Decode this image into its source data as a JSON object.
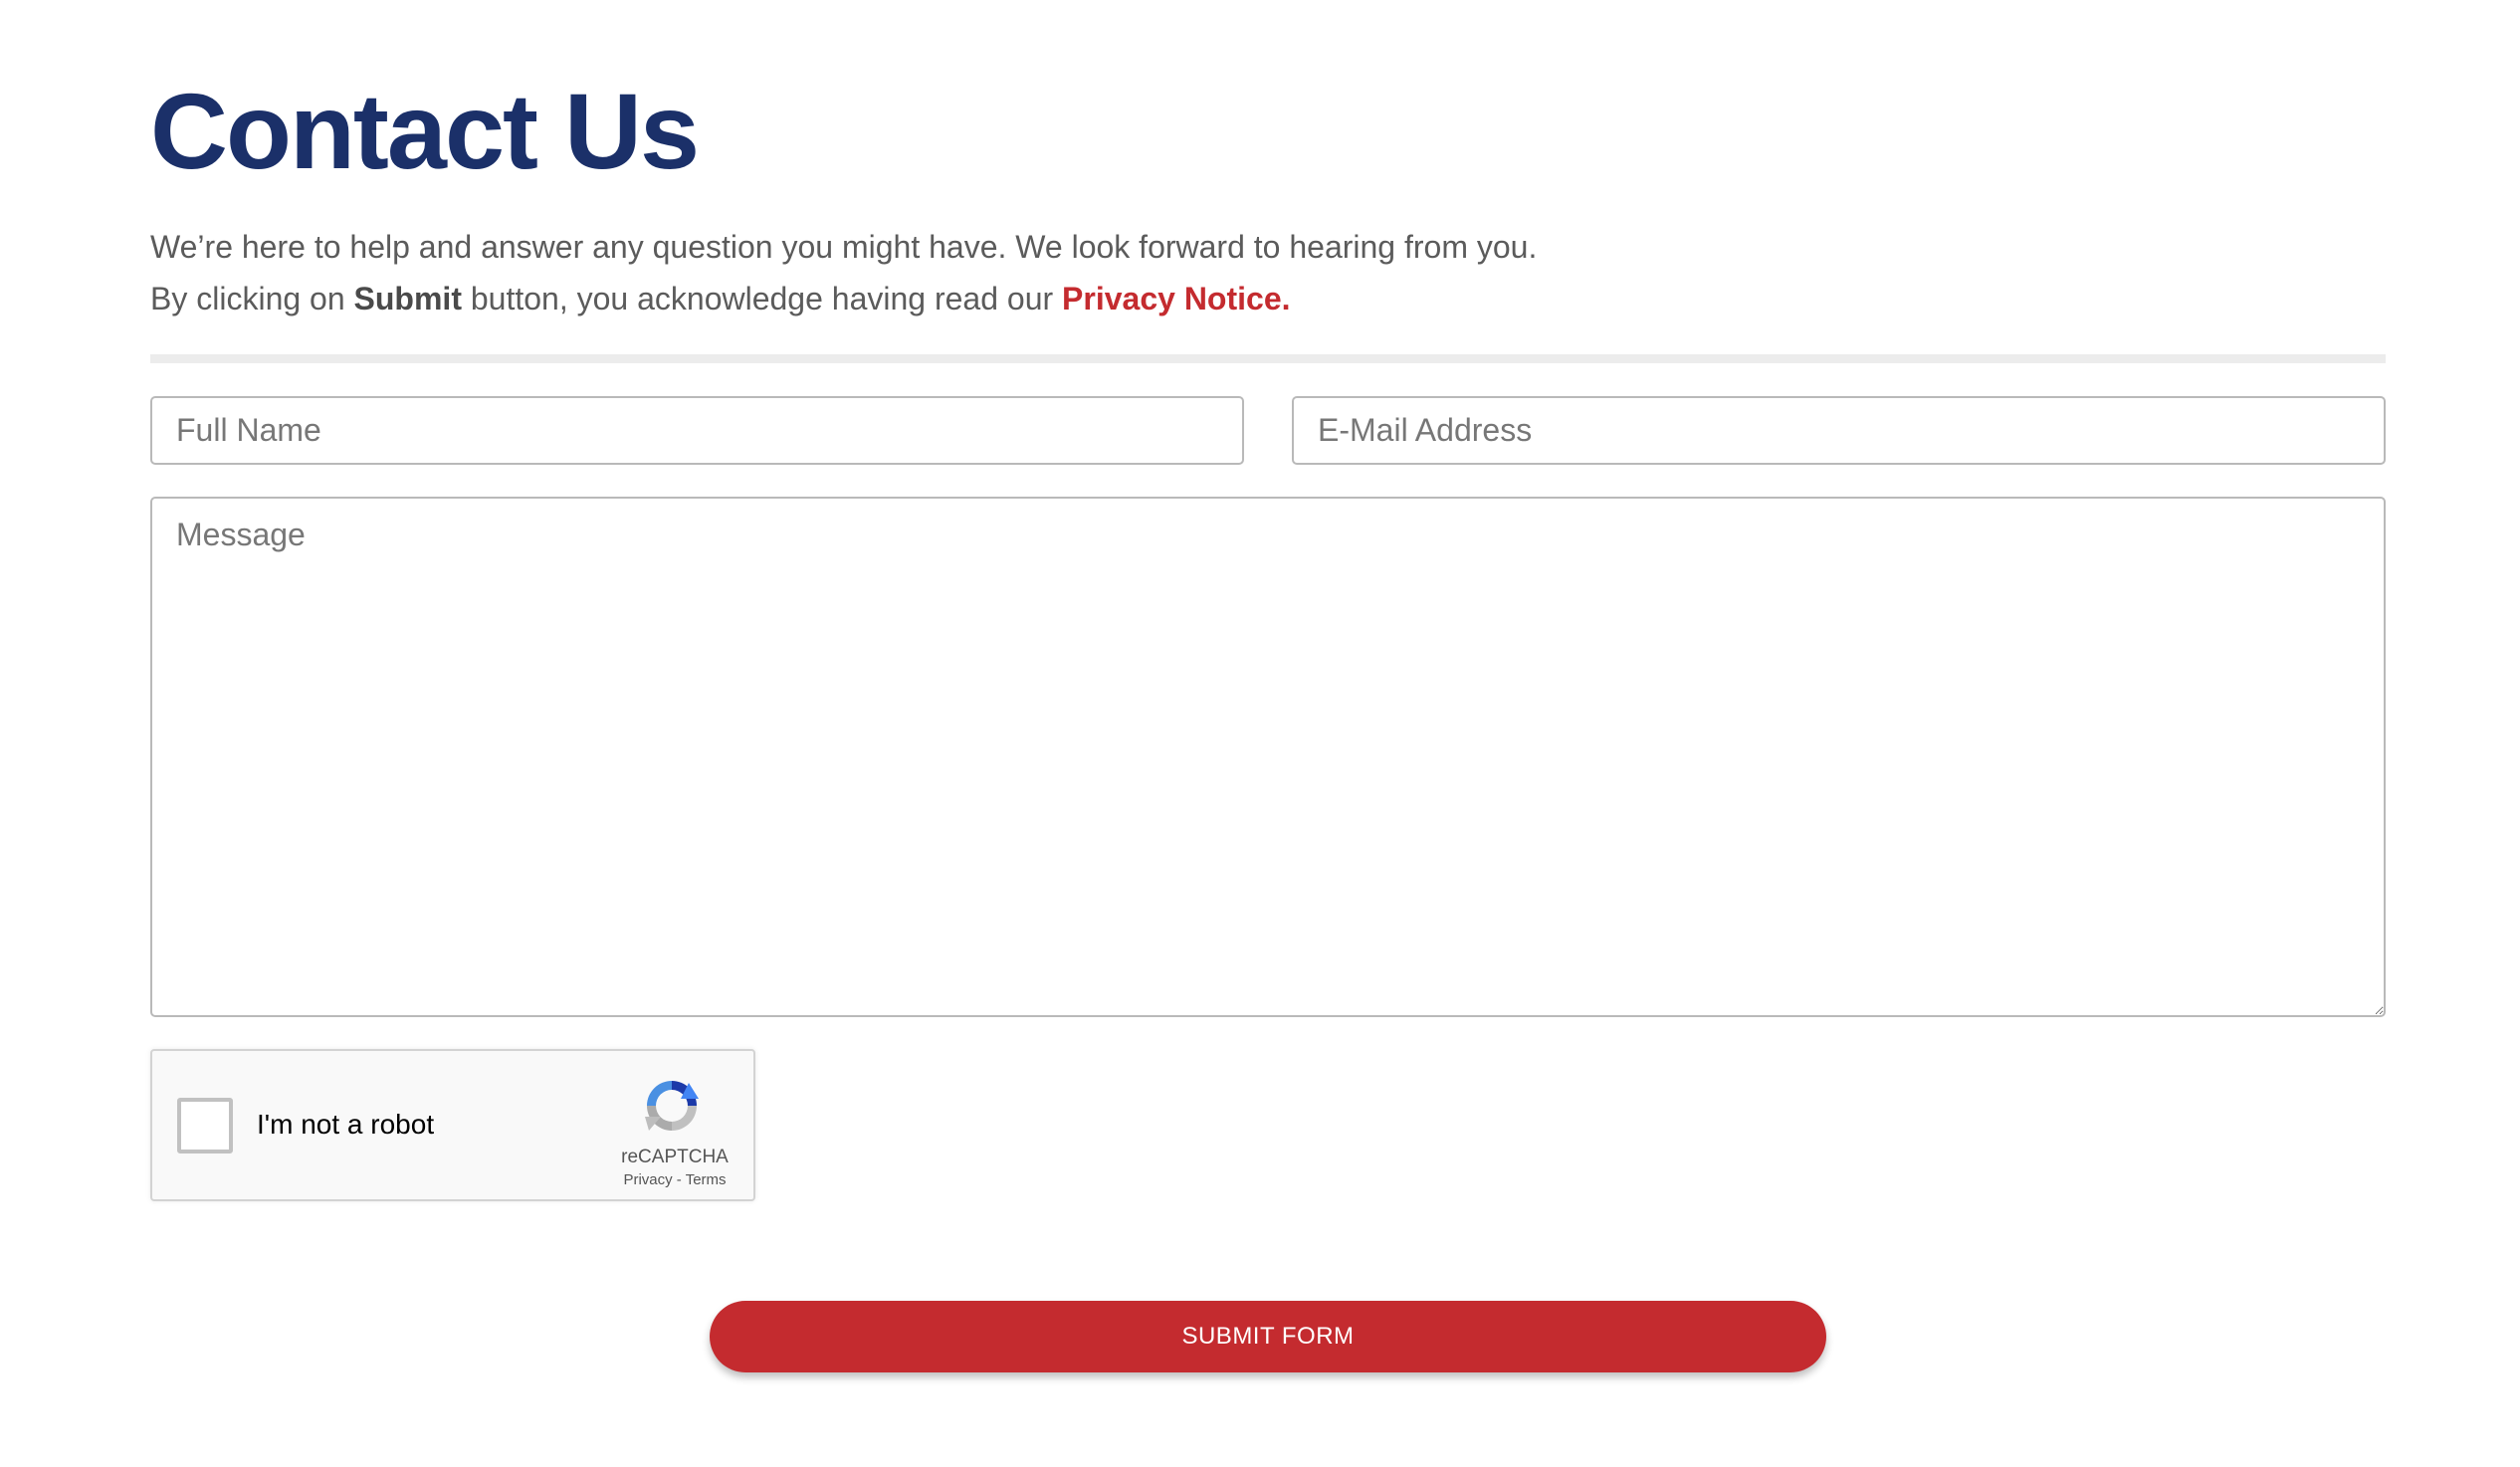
{
  "page": {
    "title": "Contact Us",
    "intro_line1": "We’re here to help and answer any question you might have. We look forward to hearing from you.",
    "intro_line2_prefix": "By clicking on ",
    "intro_line2_bold": "Submit",
    "intro_line2_middle": " button, you acknowledge having read our ",
    "privacy_link": "Privacy Notice",
    "intro_line2_suffix": "."
  },
  "form": {
    "name_placeholder": "Full Name",
    "name_value": "",
    "email_placeholder": "E-Mail Address",
    "email_value": "",
    "message_placeholder": "Message",
    "message_value": "",
    "submit_label": "SUBMIT FORM"
  },
  "captcha": {
    "label": "I'm not a robot",
    "checked": false,
    "brand": "reCAPTCHA",
    "privacy_label": "Privacy",
    "separator": " - ",
    "terms_label": "Terms",
    "icon": "recaptcha-logo-icon"
  },
  "colors": {
    "title": "#1b3069",
    "accent_red": "#c42b2f",
    "body_text": "#5b5b5b",
    "divider": "#ececec"
  }
}
